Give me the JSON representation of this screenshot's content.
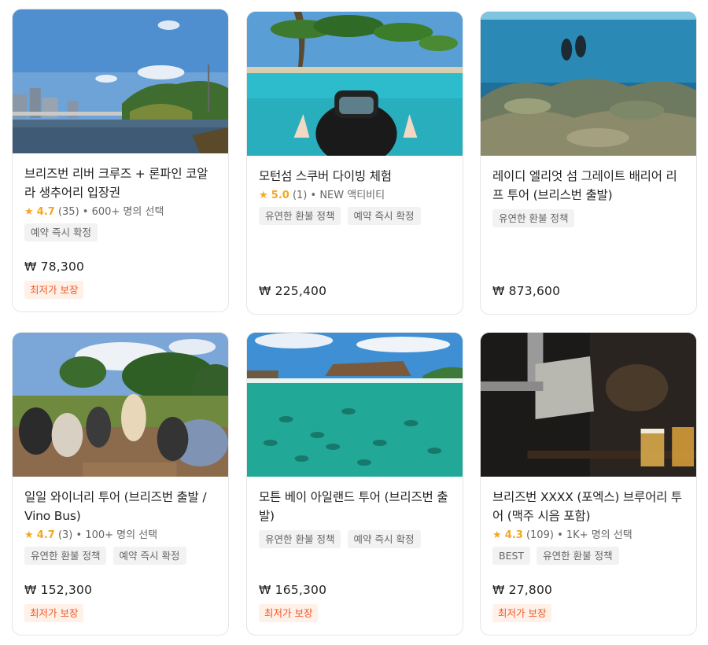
{
  "cards": [
    {
      "title": "브리즈번 리버 크루즈 + 론파인 코알라 생추어리 입장권",
      "rating": "4.7",
      "reviews": "(35)",
      "meta": "• 600+ 명의 선택",
      "tags": [
        "예약 즉시 확정"
      ],
      "price": "₩ 78,300",
      "badge": "최저가 보장"
    },
    {
      "title": "모턴섬 스쿠버 다이빙 체험",
      "rating": "5.0",
      "reviews": "(1)",
      "meta": "• NEW 액티비티",
      "tags": [
        "유연한 환불 정책",
        "예약 즉시 확정"
      ],
      "price": "₩ 225,400",
      "badge": ""
    },
    {
      "title": "레이디 엘리엇 섬 그레이트 배리어 리프 투어 (브리스번 출발)",
      "rating": "",
      "reviews": "",
      "meta": "",
      "tags": [
        "유연한 환불 정책"
      ],
      "price": "₩ 873,600",
      "badge": ""
    },
    {
      "title": "일일 와이너리 투어 (브리즈번 출발 / Vino Bus)",
      "rating": "4.7",
      "reviews": "(3)",
      "meta": "• 100+ 명의 선택",
      "tags": [
        "유연한 환불 정책",
        "예약 즉시 확정"
      ],
      "price": "₩ 152,300",
      "badge": "최저가 보장"
    },
    {
      "title": "모튼 베이 아일랜드 투어 (브리즈번 출발)",
      "rating": "",
      "reviews": "",
      "meta": "",
      "tags": [
        "유연한 환불 정책",
        "예약 즉시 확정"
      ],
      "price": "₩ 165,300",
      "badge": "최저가 보장"
    },
    {
      "title": "브리즈번 XXXX (포엑스) 브루어리 투어 (맥주 시음 포함)",
      "rating": "4.3",
      "reviews": "(109)",
      "meta": "• 1K+ 명의 선택",
      "tags": [
        "BEST",
        "유연한 환불 정책"
      ],
      "price": "₩ 27,800",
      "badge": "최저가 보장"
    }
  ],
  "icons": {
    "rating": "star-icon"
  },
  "colors": {
    "star": "#f5a623",
    "badge_text": "#f05a28",
    "badge_bg": "#fff0e8",
    "tag_bg": "#f2f2f2"
  }
}
